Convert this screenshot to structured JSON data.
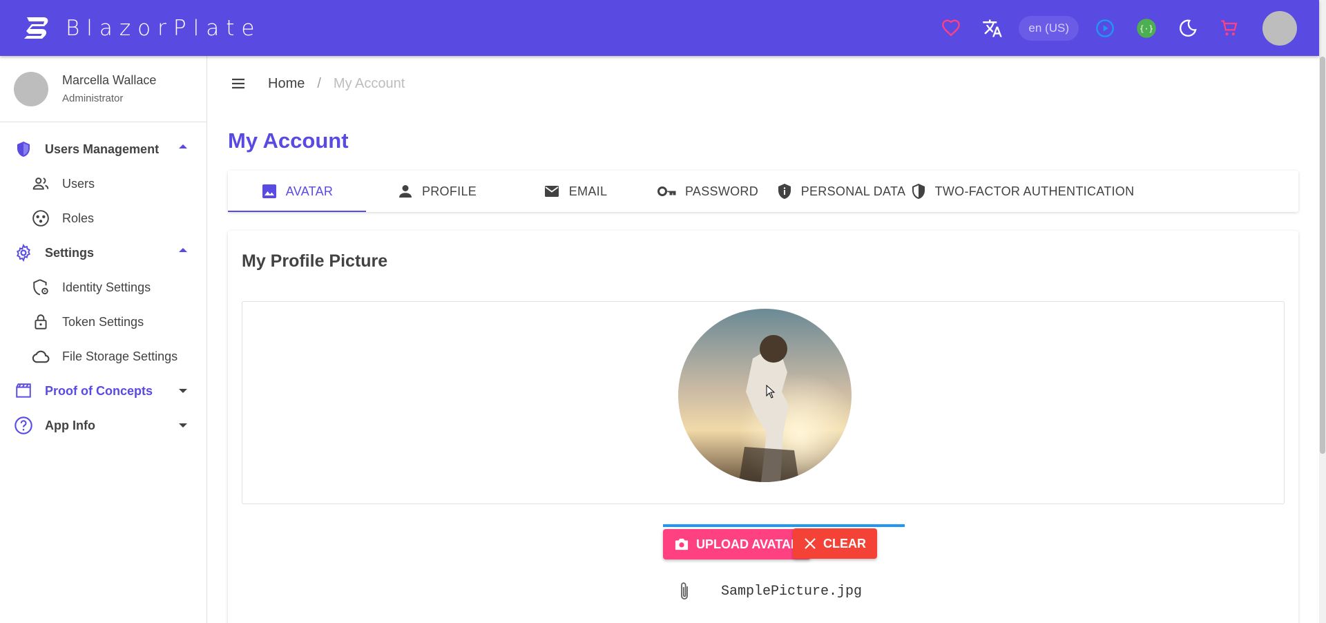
{
  "app": {
    "title": "BlazorPlate",
    "language": "en (US)",
    "colors": {
      "primary": "#594ae2",
      "pink": "#ff4081",
      "red": "#f44336",
      "blue": "#2196f3",
      "green": "#4caf50"
    },
    "icons": [
      "heart-icon",
      "translate-icon",
      "play-circle-icon",
      "api-icon",
      "moon-icon",
      "cart-icon"
    ]
  },
  "user": {
    "name": "Marcella Wallace",
    "role": "Administrator"
  },
  "sidebar": {
    "users_management": {
      "label": "Users Management",
      "items": [
        {
          "label": "Users"
        },
        {
          "label": "Roles"
        }
      ]
    },
    "settings": {
      "label": "Settings",
      "items": [
        {
          "label": "Identity Settings"
        },
        {
          "label": "Token Settings"
        },
        {
          "label": "File Storage Settings"
        }
      ]
    },
    "proof_of_concepts": {
      "label": "Proof of Concepts"
    },
    "app_info": {
      "label": "App Info"
    }
  },
  "breadcrumb": {
    "home": "Home",
    "separator": "/",
    "current": "My Account"
  },
  "page": {
    "title": "My Account"
  },
  "tabs": [
    {
      "label": "Avatar",
      "active": true
    },
    {
      "label": "Profile"
    },
    {
      "label": "Email"
    },
    {
      "label": "Password"
    },
    {
      "label": "Personal Data"
    },
    {
      "label": "Two-Factor Authentication"
    }
  ],
  "avatar_card": {
    "title": "My Profile Picture",
    "upload_label": "Upload Avatar",
    "clear_label": "Clear",
    "file_name": "SamplePicture.jpg"
  }
}
